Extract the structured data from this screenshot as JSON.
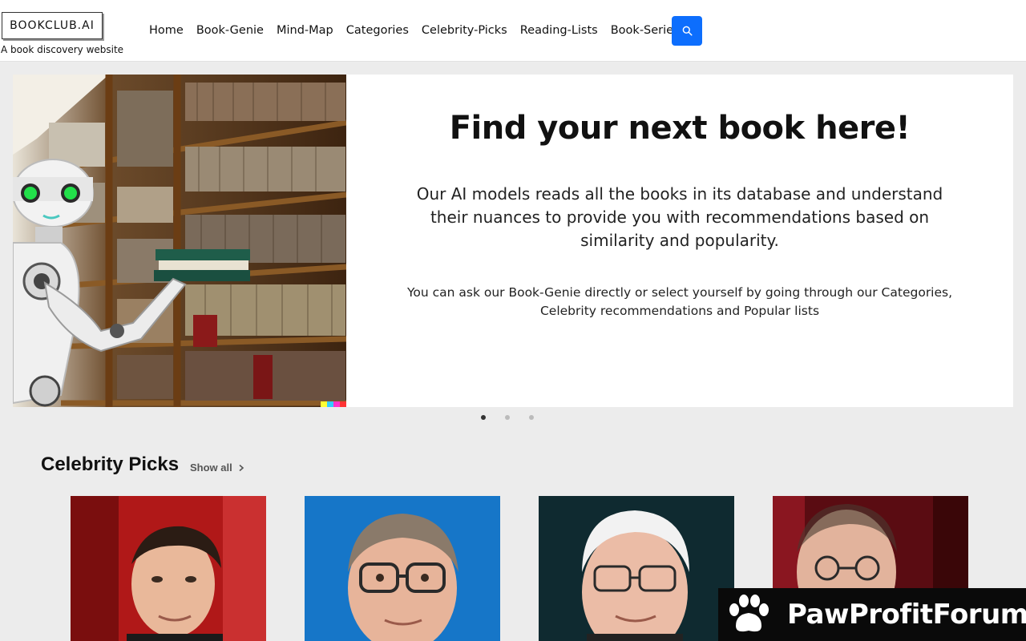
{
  "brand": {
    "logo": "BOOKCLUB.AI",
    "tagline": "A book discovery website"
  },
  "nav": {
    "items": [
      "Home",
      "Book-Genie",
      "Mind-Map",
      "Categories",
      "Celebrity-Picks",
      "Reading-Lists",
      "Book-Series"
    ],
    "search_icon": "search-icon",
    "accent": "#0d6efd"
  },
  "hero": {
    "title": "Find your next book here!",
    "description": "Our AI models reads all the books in its database and understand their nuances to provide you with recommendations based on similarity and popularity.",
    "sub": "You can ask our Book-Genie directly or select yourself by going through our Categories, Celebrity recommendations and Popular lists",
    "slides": 3,
    "active_slide": 1
  },
  "celebrity": {
    "title": "Celebrity Picks",
    "show_all": "Show all",
    "cards": 4
  },
  "watermark": {
    "text": "PawProfitForum"
  }
}
